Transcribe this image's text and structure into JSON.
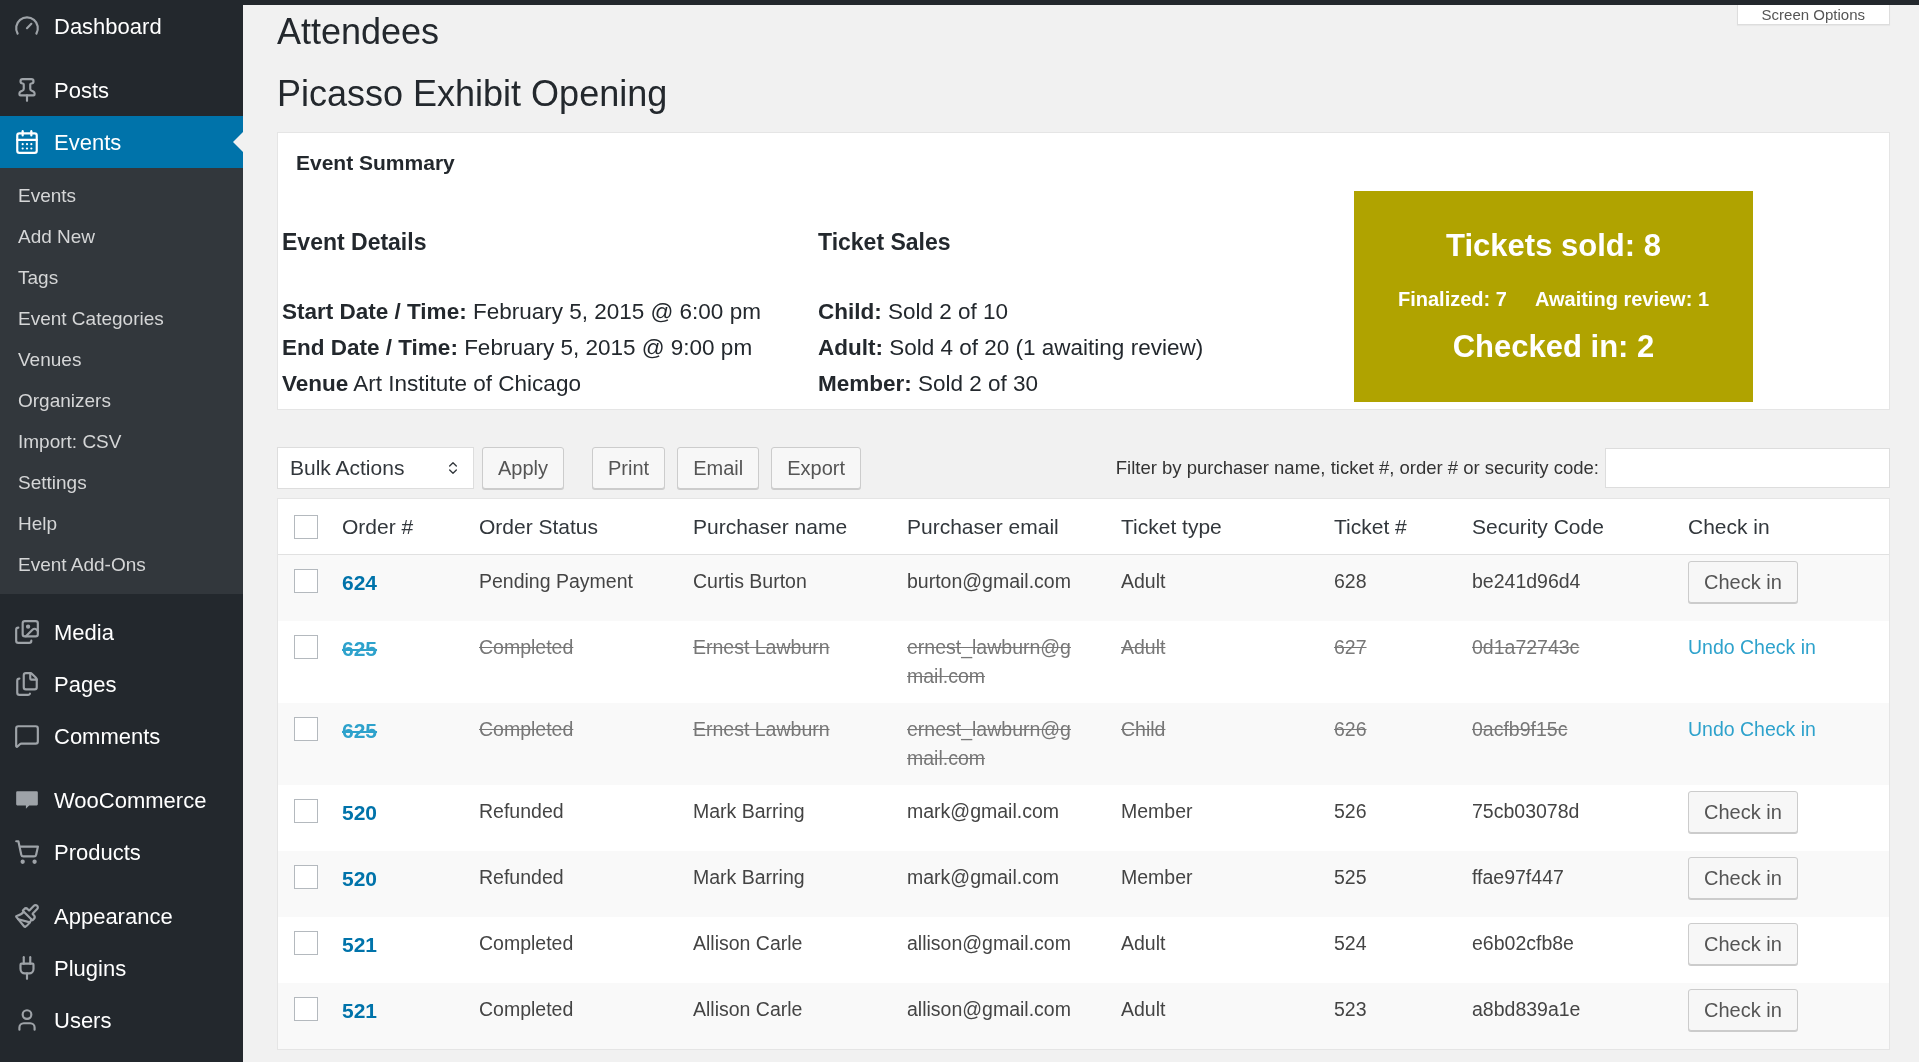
{
  "screen_options": {
    "label": "Screen Options"
  },
  "sidebar": {
    "items": [
      {
        "label": "Dashboard",
        "selected": false
      },
      {
        "label": "Posts",
        "selected": false
      },
      {
        "label": "Events",
        "selected": true,
        "children": [
          "Events",
          "Add New",
          "Tags",
          "Event Categories",
          "Venues",
          "Organizers",
          "Import: CSV",
          "Settings",
          "Help",
          "Event Add-Ons"
        ]
      },
      {
        "label": "Media",
        "selected": false
      },
      {
        "label": "Pages",
        "selected": false
      },
      {
        "label": "Comments",
        "selected": false
      },
      {
        "label": "WooCommerce",
        "selected": false
      },
      {
        "label": "Products",
        "selected": false
      },
      {
        "label": "Appearance",
        "selected": false
      },
      {
        "label": "Plugins",
        "selected": false
      },
      {
        "label": "Users",
        "selected": false
      }
    ]
  },
  "page_title": "Attendees",
  "event_title": "Picasso Exhibit Opening",
  "summary": {
    "title": "Event Summary",
    "details": {
      "heading": "Event Details",
      "lines": [
        "**Start Date / Time:** February 5, 2015 @ 6:00 pm",
        "**End Date / Time:** February 5, 2015 @ 9:00 pm",
        "**Venue** Art Institute of Chicago"
      ]
    },
    "sales": {
      "heading": "Ticket Sales",
      "lines": [
        "**Child:** Sold 2 of 10",
        "**Adult:** Sold 4 of 20 (1 awaiting review)",
        "**Member:** Sold 2 of 30"
      ]
    },
    "totals": {
      "sold": "Tickets sold: 8",
      "finalized": "Finalized: 7",
      "awaiting": "Awaiting review: 1",
      "checked_in": "Checked in: 2"
    }
  },
  "toolbar": {
    "bulk_actions": "Bulk Actions",
    "buttons": [
      "Apply",
      "Print",
      "Email",
      "Export"
    ],
    "filter_label": "Filter by purchaser name, ticket #, order # or security code:"
  },
  "table": {
    "select_all_checked": false,
    "columns": [
      "Order #",
      "Order Status",
      "Purchaser name",
      "Purchaser email",
      "Ticket type",
      "Ticket #",
      "Security Code",
      "Check in"
    ],
    "rows": [
      {
        "order": "624",
        "status": "Pending Payment",
        "name": "Curtis Burton",
        "email": "burton@gmail.com",
        "type": "Adult",
        "ticket": "628",
        "code": "be241d96d4",
        "checked": false,
        "checked_in": false,
        "action": "Check in"
      },
      {
        "order": "625",
        "status": "Completed",
        "name": "Ernest Lawburn",
        "email": "ernest_lawburn@gmail.com",
        "type": "Adult",
        "ticket": "627",
        "code": "0d1a72743c",
        "checked": false,
        "checked_in": true,
        "action": "Undo Check in"
      },
      {
        "order": "625",
        "status": "Completed",
        "name": "Ernest Lawburn",
        "email": "ernest_lawburn@gmail.com",
        "type": "Child",
        "ticket": "626",
        "code": "0acfb9f15c",
        "checked": false,
        "checked_in": true,
        "action": "Undo Check in"
      },
      {
        "order": "520",
        "status": "Refunded",
        "name": "Mark Barring",
        "email": "mark@gmail.com",
        "type": "Member",
        "ticket": "526",
        "code": "75cb03078d",
        "checked": false,
        "checked_in": false,
        "action": "Check in"
      },
      {
        "order": "520",
        "status": "Refunded",
        "name": "Mark Barring",
        "email": "mark@gmail.com",
        "type": "Member",
        "ticket": "525",
        "code": "ffae97f447",
        "checked": false,
        "checked_in": false,
        "action": "Check in"
      },
      {
        "order": "521",
        "status": "Completed",
        "name": "Allison Carle",
        "email": "allison@gmail.com",
        "type": "Adult",
        "ticket": "524",
        "code": "e6b02cfb8e",
        "checked": false,
        "checked_in": false,
        "action": "Check in"
      },
      {
        "order": "521",
        "status": "Completed",
        "name": "Allison Carle",
        "email": "allison@gmail.com",
        "type": "Adult",
        "ticket": "523",
        "code": "a8bd839a1e",
        "checked": false,
        "checked_in": false,
        "action": "Check in"
      }
    ]
  }
}
